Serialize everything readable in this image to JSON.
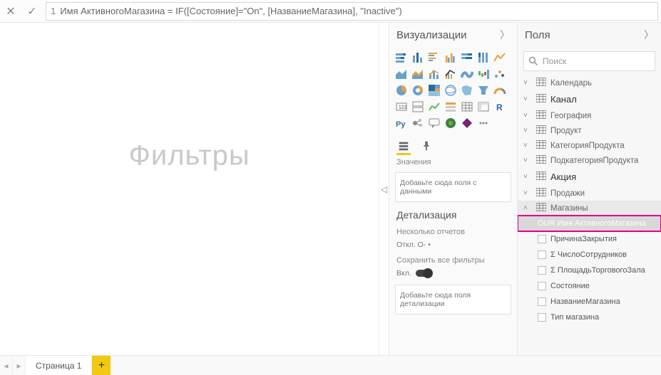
{
  "formula": {
    "line_number": "1",
    "text": "Имя АктивногоМагазина = IF([Состояние]=\"On\", [НазваниеМагазина], \"Inactive\")"
  },
  "canvas": {
    "watermark": "Фильтры"
  },
  "viz_pane": {
    "title": "Визуализации",
    "values_label": "Значения",
    "values_placeholder": "Добавьте сюда поля с данными",
    "drill_header": "Детализация",
    "cross_report_label": "Несколько отчетов",
    "cross_report_state": "Откл. О- •",
    "keep_filters_label": "Сохранить все фильтры",
    "keep_filters_state": "Вкл.",
    "drill_placeholder": "Добавьте сюда поля детализации"
  },
  "fields_pane": {
    "title": "Поля",
    "search_placeholder": "Поиск",
    "tables": [
      {
        "name": "Календарь",
        "expanded": false,
        "big": false
      },
      {
        "name": "Канал",
        "expanded": false,
        "big": true
      },
      {
        "name": "География",
        "expanded": false,
        "big": false
      },
      {
        "name": "Продукт",
        "expanded": false,
        "big": false
      },
      {
        "name": "КатегорияПродукта",
        "expanded": false,
        "big": false
      },
      {
        "name": "ПодкатегорияПродукта",
        "expanded": false,
        "big": false
      },
      {
        "name": "Акция",
        "expanded": false,
        "big": true
      },
      {
        "name": "Продажи",
        "expanded": false,
        "big": false
      },
      {
        "name": "Магазины",
        "expanded": true,
        "big": false,
        "fields": [
          {
            "label": "OUR Имя АктивногоМагазина",
            "highlight": true,
            "checkbox": false
          },
          {
            "label": "ПричинаЗакрытия",
            "checkbox": true
          },
          {
            "label": "Σ ЧислоСотрудников",
            "checkbox": true
          },
          {
            "label": "Σ ПлощадьТорговогоЗала",
            "checkbox": true
          },
          {
            "label": "Состояние",
            "checkbox": true
          },
          {
            "label": "НазваниеМагазина",
            "checkbox": true
          },
          {
            "label": "Тип магазина",
            "checkbox": true
          }
        ]
      }
    ]
  },
  "tabs": {
    "page1": "Страница 1"
  }
}
